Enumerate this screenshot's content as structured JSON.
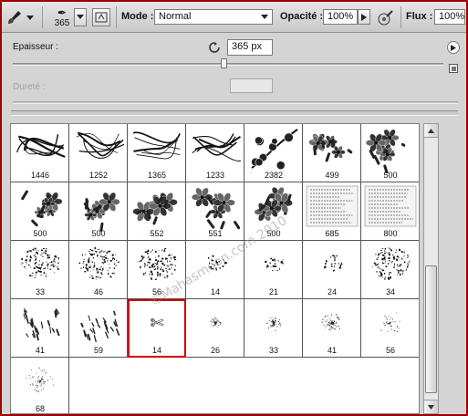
{
  "options_bar": {
    "brush_size": "365",
    "mode_label": "Mode :",
    "mode_value": "Normal",
    "opacity_label": "Opacité :",
    "opacity_value": "100%",
    "flow_label": "Flux :",
    "flow_value": "100%"
  },
  "panel": {
    "thickness_label": "Epaisseur :",
    "thickness_value": "365 px",
    "thickness_level_fraction": 0.49,
    "hardness_label": "Dureté :",
    "hardness_value": ""
  },
  "watermark": "©Mahasmoon.com 2010",
  "brushes": [
    {
      "label": "1446",
      "kind": "calligraphy"
    },
    {
      "label": "1252",
      "kind": "calligraphy"
    },
    {
      "label": "1365",
      "kind": "calligraphy"
    },
    {
      "label": "1233",
      "kind": "calligraphy"
    },
    {
      "label": "2382",
      "kind": "flowerbranch"
    },
    {
      "label": "499",
      "kind": "flower"
    },
    {
      "label": "500",
      "kind": "flower"
    },
    {
      "label": "500",
      "kind": "flower"
    },
    {
      "label": "500",
      "kind": "flower"
    },
    {
      "label": "552",
      "kind": "flower"
    },
    {
      "label": "551",
      "kind": "flower"
    },
    {
      "label": "500",
      "kind": "flower"
    },
    {
      "label": "685",
      "kind": "document"
    },
    {
      "label": "800",
      "kind": "document"
    },
    {
      "label": "33",
      "kind": "spatter"
    },
    {
      "label": "46",
      "kind": "spatter"
    },
    {
      "label": "56",
      "kind": "spatter"
    },
    {
      "label": "14",
      "kind": "spatter-small"
    },
    {
      "label": "21",
      "kind": "spatter-small"
    },
    {
      "label": "24",
      "kind": "spatter-small"
    },
    {
      "label": "34",
      "kind": "spatter"
    },
    {
      "label": "41",
      "kind": "dabs"
    },
    {
      "label": "59",
      "kind": "dabs"
    },
    {
      "label": "14",
      "kind": "scissors",
      "selected": true
    },
    {
      "label": "26",
      "kind": "soft"
    },
    {
      "label": "33",
      "kind": "soft"
    },
    {
      "label": "41",
      "kind": "soft"
    },
    {
      "label": "56",
      "kind": "soft"
    },
    {
      "label": "68",
      "kind": "soft"
    }
  ],
  "icons": {
    "tool": "brush-icon",
    "panel_toggle": "brush-panel-toggle-icon",
    "airbrush": "airbrush-icon",
    "reset": "reset-icon",
    "flyout": "panel-menu-icon",
    "new_preset": "new-preset-icon"
  }
}
